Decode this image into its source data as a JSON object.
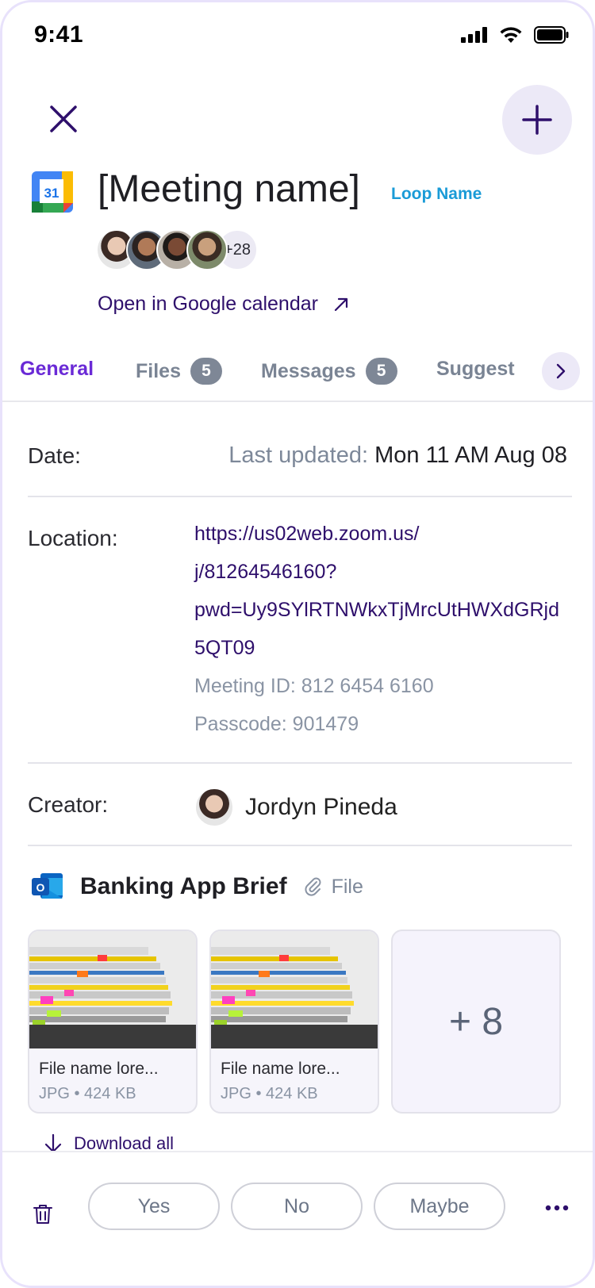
{
  "status_bar": {
    "time": "9:41"
  },
  "header": {
    "title": "[Meeting name]",
    "loop_name": "Loop Name",
    "calendar_logo_text": "31",
    "attendees_more": "+28",
    "open_calendar_link": "Open in Google calendar"
  },
  "tabs": [
    {
      "label": "General",
      "active": true
    },
    {
      "label": "Files",
      "badge": "5"
    },
    {
      "label": "Messages",
      "badge": "5"
    },
    {
      "label": "Suggest"
    }
  ],
  "date_row": {
    "label": "Date:",
    "updated_label": "Last updated:",
    "updated_value": "Mon 11 AM  Aug 08"
  },
  "location_row": {
    "label": "Location:",
    "link_lines": [
      "https://us02web.zoom.us/",
      "j/81264546160?",
      "pwd=Uy9SYlRTNWkxTjMrcUtHWXdGRjd",
      "5QT09"
    ],
    "meeting_id": "Meeting ID: 812 6454 6160",
    "passcode": "Passcode: 901479"
  },
  "creator_row": {
    "label": "Creator:",
    "name": "Jordyn Pineda"
  },
  "attachment": {
    "title": "Banking App Brief",
    "type_label": "File",
    "files": [
      {
        "name": "File name lore...",
        "meta": "JPG • 424 KB"
      },
      {
        "name": "File name lore...",
        "meta": "JPG • 424 KB"
      }
    ],
    "more_count": "+ 8",
    "download_all": "Download all"
  },
  "rsvp": {
    "yes": "Yes",
    "no": "No",
    "maybe": "Maybe"
  },
  "colors": {
    "accent": "#6a2ad6",
    "link": "#2e0f6b",
    "loop": "#1a9bd7",
    "muted": "#7d8899"
  }
}
